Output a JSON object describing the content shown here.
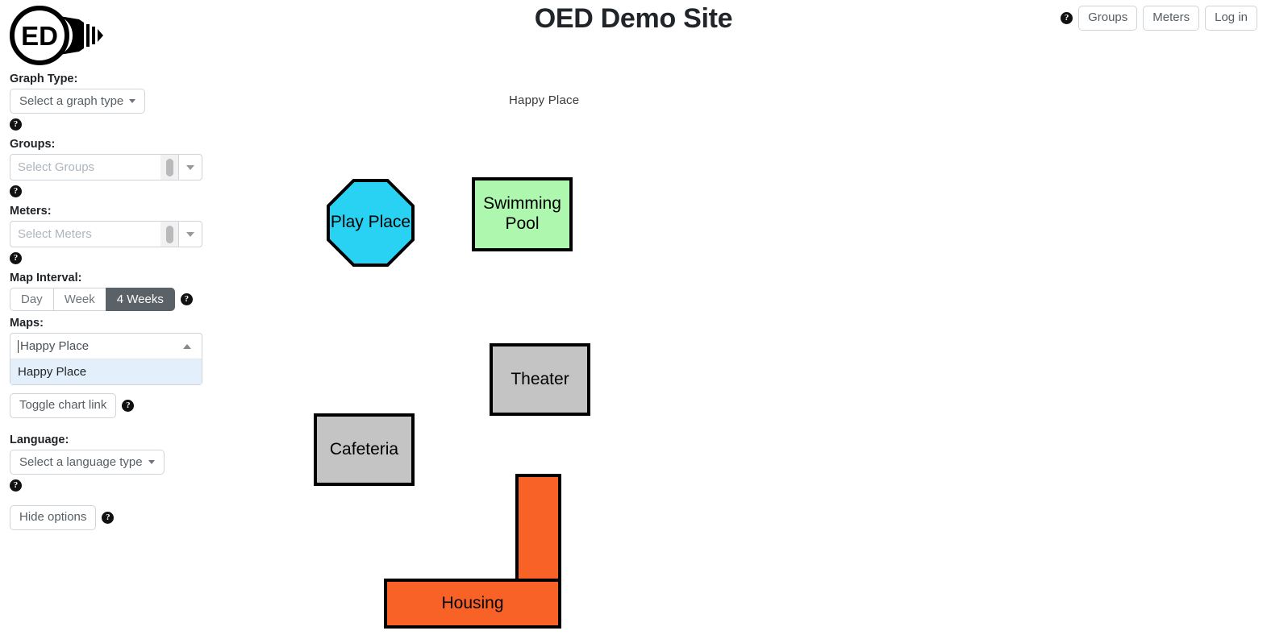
{
  "header": {
    "title": "OED Demo Site",
    "logo_text": "ED",
    "help_icon": "help-circle-icon",
    "buttons": [
      {
        "label": "Groups",
        "name": "groups-button"
      },
      {
        "label": "Meters",
        "name": "meters-button"
      },
      {
        "label": "Log in",
        "name": "login-button"
      }
    ]
  },
  "sidebar": {
    "graph_type": {
      "label": "Graph Type:",
      "button_label": "Select a graph type"
    },
    "groups": {
      "label": "Groups:",
      "placeholder": "Select Groups"
    },
    "meters": {
      "label": "Meters:",
      "placeholder": "Select Meters"
    },
    "map_interval": {
      "label": "Map Interval:",
      "options": [
        {
          "label": "Day",
          "selected": false
        },
        {
          "label": "Week",
          "selected": false
        },
        {
          "label": "4 Weeks",
          "selected": true
        }
      ]
    },
    "maps": {
      "label": "Maps:",
      "value": "Happy Place",
      "expanded": true,
      "options": [
        "Happy Place"
      ]
    },
    "toggle_chart_link": "Toggle chart link",
    "language": {
      "label": "Language:",
      "button_label": "Select a language type"
    },
    "hide_options": "Hide options"
  },
  "map": {
    "name": "Happy Place",
    "colors": {
      "play_place": "#29d2f2",
      "swimming_pool": "#aef7ae",
      "theater": "#c4c4c4",
      "cafeteria": "#c4c4c4",
      "housing": "#f96227",
      "outline": "#000000"
    },
    "shapes": [
      {
        "label": "Play Place",
        "type": "octagon",
        "color": "#29d2f2"
      },
      {
        "label": "Swimming Pool",
        "type": "rectangle",
        "color": "#aef7ae"
      },
      {
        "label": "Theater",
        "type": "rectangle",
        "color": "#c4c4c4"
      },
      {
        "label": "Cafeteria",
        "type": "rectangle",
        "color": "#c4c4c4"
      },
      {
        "label": "Housing",
        "type": "l-shape",
        "color": "#f96227"
      }
    ]
  }
}
